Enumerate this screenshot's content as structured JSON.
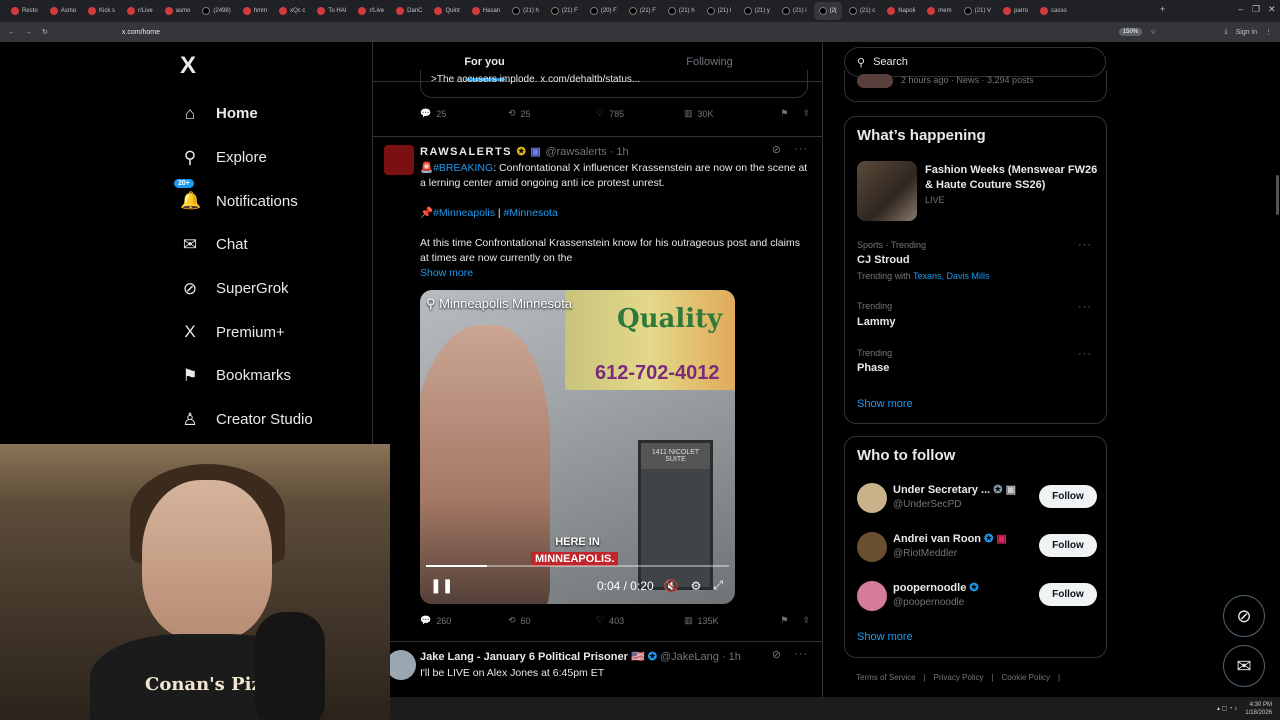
{
  "browser": {
    "tabs": [
      "Resto",
      "Asmo",
      "Kick s",
      "r/Live",
      "asmo",
      "(2498)",
      "hmm",
      "xQc c",
      "To HAI",
      "r/Live",
      "DanC",
      "Quint",
      "Hasan",
      "(21) h",
      "(21) F",
      "(20) F",
      "(21) F",
      "(21) h",
      "(21) I",
      "(21) y",
      "(21) i",
      "(2(",
      "(21) c",
      "Napoli",
      "mem",
      "(21) V",
      "parro",
      "casso"
    ],
    "active_tab_index": 21,
    "url": "x.com/home",
    "zoom": "150%",
    "sign_in": "Sign in"
  },
  "x_logo": "X",
  "nav": {
    "items": [
      {
        "label": "Home",
        "icon": "home-icon",
        "glyph": "⌂"
      },
      {
        "label": "Explore",
        "icon": "search-icon",
        "glyph": "⚲"
      },
      {
        "label": "Notifications",
        "icon": "bell-icon",
        "glyph": "🔔"
      },
      {
        "label": "Chat",
        "icon": "mail-icon",
        "glyph": "✉"
      },
      {
        "label": "SuperGrok",
        "icon": "grok-icon",
        "glyph": "⊘"
      },
      {
        "label": "Premium+",
        "icon": "x-icon",
        "glyph": "X"
      },
      {
        "label": "Bookmarks",
        "icon": "bookmark-icon",
        "glyph": "⚑"
      },
      {
        "label": "Creator Studio",
        "icon": "creator-icon",
        "glyph": "♙"
      }
    ],
    "notification_badge": "20+"
  },
  "feed": {
    "tabs": [
      "For you",
      "Following"
    ],
    "quote_text": ">The accusers implode. x.com/dehaltb/status...",
    "post1_actions": {
      "replies": "25",
      "reposts": "25",
      "likes": "785",
      "views": "30K"
    },
    "post2": {
      "name": "RAWSALERTS",
      "handle": "@rawsalerts · 1h",
      "line1_tag": "#BREAKING",
      "line1_text": ": Confrontational X influencer Krassenstein are now on the scene at a lerning center amid ongoing anti ice protest unrest.",
      "tag_a": "#Minneapolis",
      "sep": " | ",
      "tag_b": "#Minnesota",
      "body": "At this time Confrontational Krassenstein know for his outrageous post and claims at times are now currently on the",
      "show_more": "Show more",
      "video_location": "Minneapolis Minnesota",
      "caption_1": "HERE IN",
      "caption_2": "MINNEAPOLIS.",
      "video_time": "0:04 / 0:20",
      "video_progress": 0.2,
      "sign_text": "Quality",
      "sign_phone": "612-702-4012",
      "door_text": "1411 NICOLET SUITE",
      "actions": {
        "replies": "260",
        "reposts": "60",
        "likes": "403",
        "views": "135K"
      }
    },
    "post3": {
      "name": "Jake Lang - January 6 Political Prisoner",
      "handle": "@JakeLang · 1h",
      "text": "I'll be LIVE on Alex Jones at 6:45pm ET"
    }
  },
  "right": {
    "search_placeholder": "Search",
    "top_meta": "2 hours ago · News · 3,294 posts",
    "whats_happening": "What’s happening",
    "event_title": "Fashion Weeks (Menswear FW26 & Haute Couture SS26)",
    "event_status": "LIVE",
    "trends": [
      {
        "meta": "Sports · Trending",
        "name": "CJ Stroud",
        "with": "Trending with ",
        "links": "Texans, Davis Mills"
      },
      {
        "meta": "Trending",
        "name": "Lammy"
      },
      {
        "meta": "Trending",
        "name": "Phase"
      }
    ],
    "show_more": "Show more",
    "who_to_follow": "Who to follow",
    "follow": [
      {
        "name": "Under Secretary ...",
        "handle": "@UnderSecPD"
      },
      {
        "name": "Andrei van Roon",
        "handle": "@RiotMeddler"
      },
      {
        "name": "poopernoodle",
        "handle": "@poopernoodle"
      }
    ],
    "follow_label": "Follow",
    "footer": [
      "Terms of Service",
      "Privacy Policy",
      "Cookie Policy"
    ]
  },
  "webcam": {
    "shirt_text": "Conan's Pizza"
  },
  "taskbar": {
    "time": "4:30 PM",
    "date": "1/18/2026"
  },
  "colors": {
    "accent": "#1d9bf0",
    "bg": "#000000",
    "border": "#2f3336"
  }
}
